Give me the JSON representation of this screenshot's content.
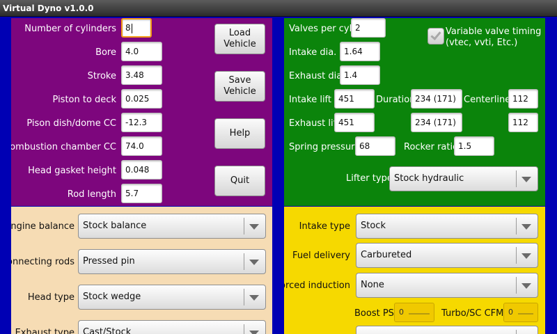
{
  "window": {
    "title": "Virtual Dyno v1.0.0"
  },
  "engine": {
    "cylinders_label": "Number of cylinders",
    "cylinders_value": "8",
    "bore_label": "Bore",
    "bore_value": "4.0",
    "stroke_label": "Stroke",
    "stroke_value": "3.48",
    "piston_deck_label": "Piston to deck",
    "piston_deck_value": "0.025",
    "dish_label": "Pison dish/dome CC",
    "dish_value": "-12.3",
    "chamber_label": "Combustion chamber CC",
    "chamber_value": "74.0",
    "gasket_label": "Head gasket height",
    "gasket_value": "0.048",
    "rod_label": "Rod length",
    "rod_value": "5.7"
  },
  "buttons": {
    "load": "Load\nVehicle",
    "save": "Save\nVehicle",
    "help": "Help",
    "quit": "Quit"
  },
  "valvetrain": {
    "valves_label": "Valves per cyl.",
    "valves_value": "2",
    "vvt_label": "Variable valve timing\n(vtec, vvti, Etc.)",
    "vvt_checked": true,
    "intake_dia_label": "Intake dia.",
    "intake_dia_value": "1.64",
    "exhaust_dia_label": "Exhaust dia.",
    "exhaust_dia_value": "1.4",
    "intake_lift_label": "Intake lift",
    "intake_lift_value": "451",
    "duration_label": "Duration",
    "intake_duration_value": "234  (171)",
    "centerline_label": "Centerline",
    "intake_centerline_value": "112",
    "exhaust_lift_label": "Exhaust lift",
    "exhaust_lift_value": "451",
    "exhaust_duration_value": "234  (171)",
    "exhaust_centerline_value": "112",
    "spring_label": "Spring pressure",
    "spring_value": "68",
    "rocker_label": "Rocker ratio",
    "rocker_value": "1.5",
    "lifter_label": "Lifter type",
    "lifter_value": "Stock hydraulic"
  },
  "block": {
    "balance_label": "Engine balance",
    "balance_value": "Stock balance",
    "rods_label": "Connecting rods",
    "rods_value": "Pressed pin",
    "head_label": "Head type",
    "head_value": "Stock wedge",
    "exhaust_label": "Exhaust type",
    "exhaust_value": "Cast/Stock"
  },
  "induction": {
    "intake_label": "Intake type",
    "intake_value": "Stock",
    "fuel_label": "Fuel delivery",
    "fuel_value": "Carbureted",
    "forced_label": "Forced induction",
    "forced_value": "None",
    "boost_label": "Boost PSI",
    "boost_value": "0",
    "cfm_label": "Turbo/SC CFM",
    "cfm_value": "0"
  },
  "colors": {
    "engine_panel": "#7d067d",
    "valve_panel": "#0b840b",
    "block_panel": "#f6dcb4",
    "induction_panel": "#f6d900",
    "background": "#0000b4"
  }
}
